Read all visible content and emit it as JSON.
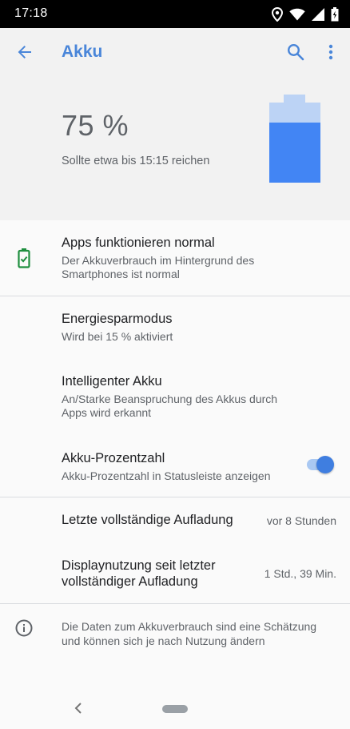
{
  "status_bar": {
    "time": "17:18",
    "icons": [
      "location-icon",
      "wifi-icon",
      "cell-signal-icon",
      "battery-icon"
    ]
  },
  "app_bar": {
    "title": "Akku",
    "back_icon": "arrow-back-icon",
    "search_icon": "search-icon",
    "menu_icon": "more-vert-icon",
    "accent_color": "#4a86d9"
  },
  "battery_summary": {
    "level_text": "75 %",
    "level_fraction": 0.75,
    "estimate": "Sollte etwa bis 15:15 reichen",
    "fill_color": "#4285f4",
    "empty_color": "#bcd3f5"
  },
  "items": {
    "apps_status": {
      "title": "Apps funktionieren normal",
      "subtitle": "Der Akkuverbrauch im Hintergrund des Smartphones ist normal",
      "icon": "battery-check-icon",
      "icon_color": "#1e8e3e"
    },
    "saver": {
      "title": "Energiesparmodus",
      "subtitle": "Wird bei 15 % aktiviert"
    },
    "adaptive": {
      "title": "Intelligenter Akku",
      "subtitle": "An/Starke Beanspruchung des Akkus durch Apps wird erkannt"
    },
    "percentage": {
      "title": "Akku-Prozentzahl",
      "subtitle": "Akku-Prozentzahl in Statusleiste anzeigen",
      "toggle_on": true
    },
    "last_charge": {
      "title": "Letzte vollständige Aufladung",
      "value": "vor 8 Stunden"
    },
    "screen_usage": {
      "title_line1": "Displaynutzung seit letzter",
      "title_line2": "vollständiger Aufladung",
      "value": "1 Std., 39 Min."
    },
    "info": {
      "text_line1": "Die Daten zum Akkuverbrauch sind eine Schätzung",
      "text_line2": "und können sich je nach Nutzung ändern",
      "icon": "info-icon"
    }
  },
  "nav_bar": {
    "back_icon": "nav-back-icon",
    "home_icon": "home-pill-icon"
  }
}
